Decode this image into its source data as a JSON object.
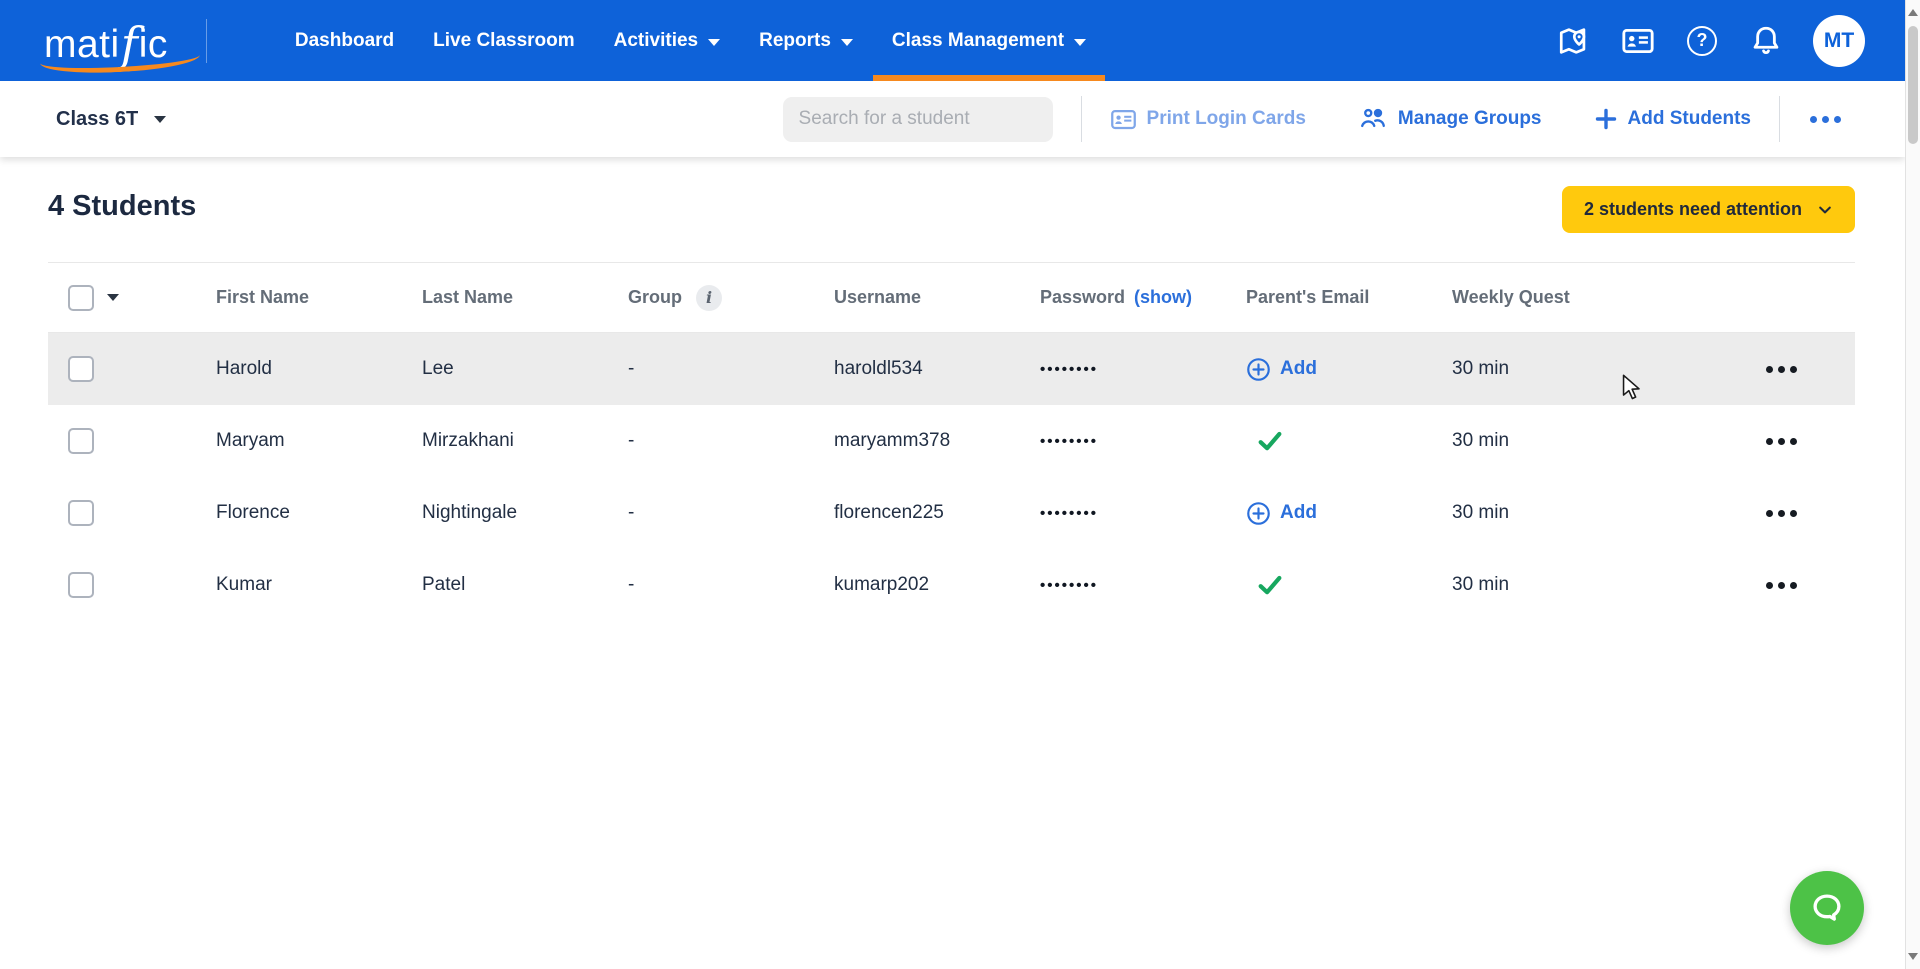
{
  "colors": {
    "topbar_blue": "#0E62D9",
    "accent_orange": "#F6891E",
    "link_blue": "#2B6FDB",
    "muted_link_blue": "#7FA6E9",
    "badge_yellow": "#FFC90D",
    "success_green": "#17A75F",
    "chat_green": "#4DC247",
    "row_hover_gray": "#ECECEC"
  },
  "brand": {
    "logo": "matific",
    "logo_parts": {
      "pre": "mati",
      "f": "f",
      "post": "ic"
    }
  },
  "topnav": {
    "items": [
      {
        "label": "Dashboard",
        "has_dropdown": false,
        "active": false
      },
      {
        "label": "Live Classroom",
        "has_dropdown": false,
        "active": false
      },
      {
        "label": "Activities",
        "has_dropdown": true,
        "active": false
      },
      {
        "label": "Reports",
        "has_dropdown": true,
        "active": false
      },
      {
        "label": "Class Management",
        "has_dropdown": true,
        "active": true
      }
    ],
    "icons": [
      "map-icon",
      "id-card-icon",
      "help-icon",
      "notifications-icon"
    ],
    "avatar_initials": "MT"
  },
  "toolbar": {
    "class_selector": {
      "label": "Class 6T"
    },
    "search": {
      "placeholder": "Search for a student",
      "value": "",
      "icon": "search-icon"
    },
    "actions": {
      "print_login_cards": "Print Login Cards",
      "manage_groups": "Manage Groups",
      "add_students": "Add Students"
    },
    "overflow_icon": "ellipsis-icon"
  },
  "content": {
    "heading": "4 Students",
    "attention_badge": {
      "label": "2 students need attention",
      "icon": "chevron-down-icon"
    }
  },
  "table": {
    "columns": {
      "first_name": "First Name",
      "last_name": "Last Name",
      "group": "Group",
      "username": "Username",
      "password": "Password",
      "password_show": "(show)",
      "parents_email": "Parent's Email",
      "weekly_quest": "Weekly Quest"
    },
    "group_info_icon": "info-icon",
    "add_email_label": "Add",
    "added_email_icon": "check-icon",
    "row_menu_icon": "ellipsis-icon",
    "rows": [
      {
        "first_name": "Harold",
        "last_name": "Lee",
        "group": "-",
        "username": "haroldl534",
        "password_masked": "••••••••",
        "parents_email_status": "add",
        "weekly_quest": "30 min",
        "highlighted": true
      },
      {
        "first_name": "Maryam",
        "last_name": "Mirzakhani",
        "group": "-",
        "username": "maryamm378",
        "password_masked": "••••••••",
        "parents_email_status": "added",
        "weekly_quest": "30 min",
        "highlighted": false
      },
      {
        "first_name": "Florence",
        "last_name": "Nightingale",
        "group": "-",
        "username": "florencen225",
        "password_masked": "••••••••",
        "parents_email_status": "add",
        "weekly_quest": "30 min",
        "highlighted": false
      },
      {
        "first_name": "Kumar",
        "last_name": "Patel",
        "group": "-",
        "username": "kumarp202",
        "password_masked": "••••••••",
        "parents_email_status": "added",
        "weekly_quest": "30 min",
        "highlighted": false
      }
    ]
  },
  "chat_button": {
    "icon": "chat-bubble-icon"
  }
}
